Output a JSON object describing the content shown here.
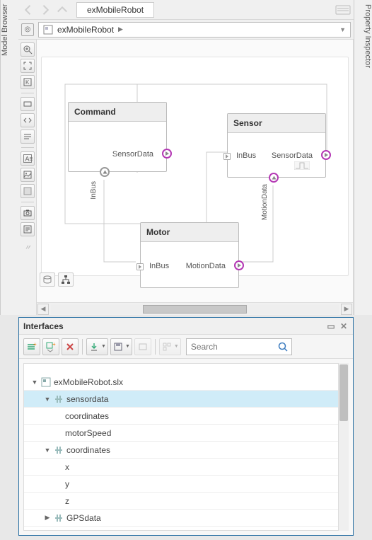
{
  "rails": {
    "left": "Model Browser",
    "right": "Property Inspector"
  },
  "nav": {
    "tab": "exMobileRobot"
  },
  "breadcrumb": {
    "root": "exMobileRobot"
  },
  "blocks": {
    "command": {
      "title": "Command",
      "out": "SensorData",
      "bottom": "InBus"
    },
    "sensor": {
      "title": "Sensor",
      "in": "InBus",
      "out": "SensorData",
      "bottom": "MotionData"
    },
    "motor": {
      "title": "Motor",
      "in": "InBus",
      "out": "MotionData"
    }
  },
  "interfaces": {
    "title": "Interfaces",
    "search_placeholder": "Search",
    "file": "exMobileRobot.slx",
    "tree": {
      "sensordata": {
        "label": "sensordata",
        "children": [
          "coordinates",
          "motorSpeed"
        ]
      },
      "coordinates": {
        "label": "coordinates",
        "children": [
          "x",
          "y",
          "z"
        ]
      },
      "gpsdata": {
        "label": "GPSdata"
      }
    }
  }
}
